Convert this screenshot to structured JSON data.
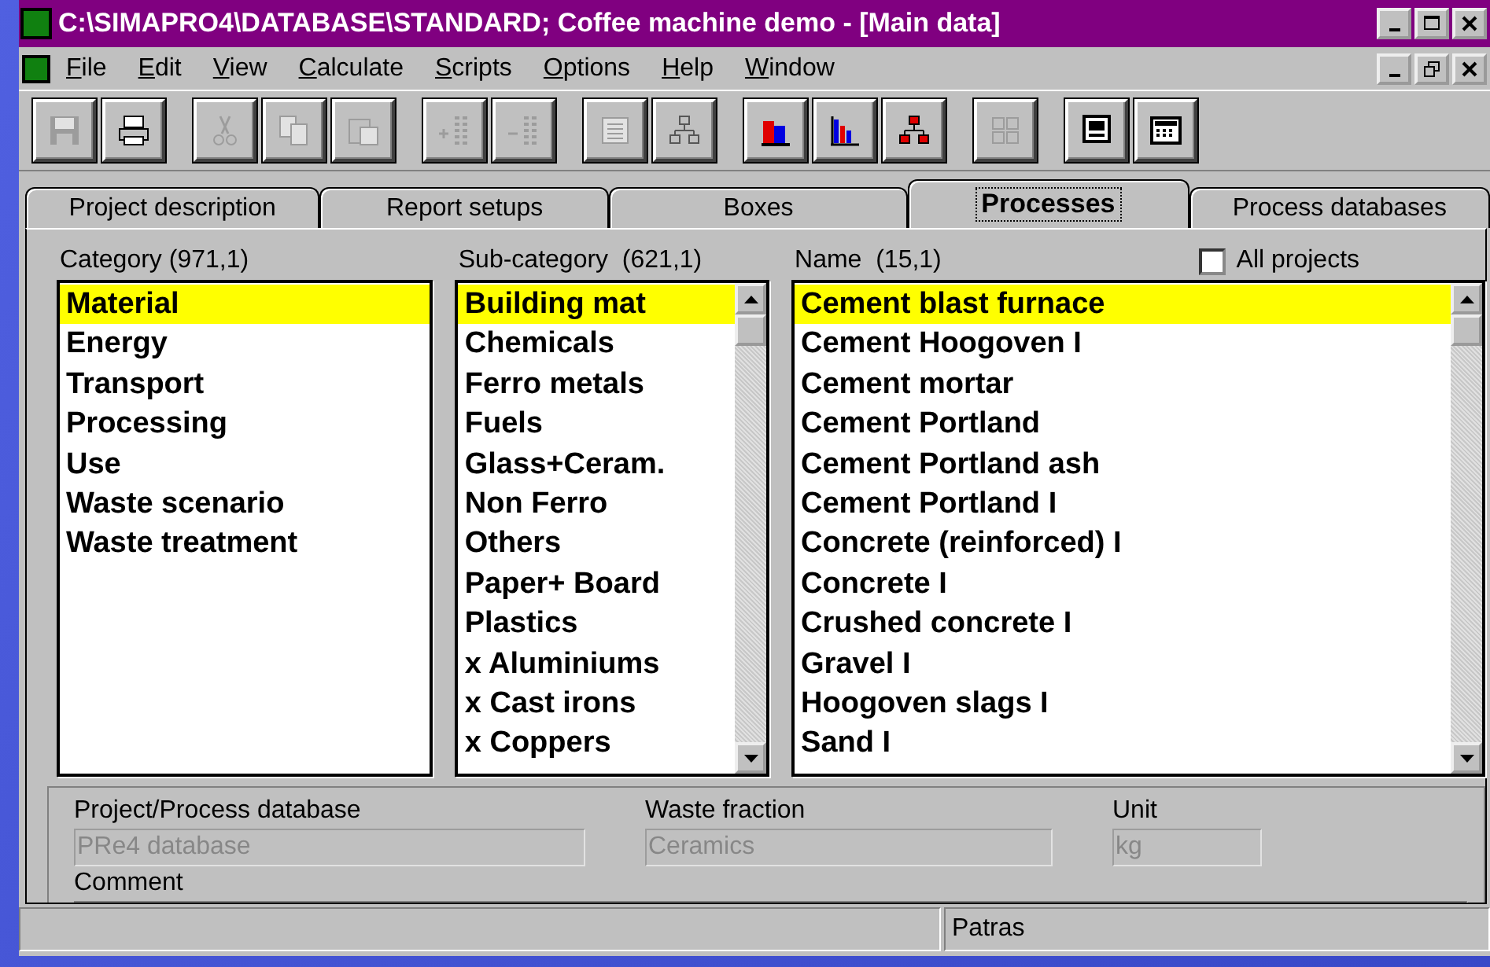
{
  "window": {
    "title": "C:\\SIMAPRO4\\DATABASE\\STANDARD; Coffee machine demo - [Main data]"
  },
  "menu": [
    "File",
    "Edit",
    "View",
    "Calculate",
    "Scripts",
    "Options",
    "Help",
    "Window"
  ],
  "toolbar": [
    [
      {
        "kind": "save",
        "disabled": true
      },
      {
        "kind": "print",
        "disabled": false
      }
    ],
    [
      {
        "kind": "cut",
        "disabled": true
      },
      {
        "kind": "copy",
        "disabled": true
      },
      {
        "kind": "paste",
        "disabled": true
      }
    ],
    [
      {
        "kind": "add-rows",
        "disabled": true
      },
      {
        "kind": "remove-rows",
        "disabled": true
      }
    ],
    [
      {
        "kind": "document",
        "disabled": true
      },
      {
        "kind": "tree",
        "disabled": true
      }
    ],
    [
      {
        "kind": "bar-chart",
        "disabled": false
      },
      {
        "kind": "column-chart",
        "disabled": false
      },
      {
        "kind": "tree",
        "disabled": false
      }
    ],
    [
      {
        "kind": "grid",
        "disabled": true
      }
    ],
    [
      {
        "kind": "monitor",
        "disabled": false
      },
      {
        "kind": "keyboard",
        "disabled": false
      }
    ]
  ],
  "tabs": [
    {
      "label": "Project description",
      "selected": false
    },
    {
      "label": "Report setups",
      "selected": false
    },
    {
      "label": "Boxes",
      "selected": false
    },
    {
      "label": "Processes",
      "selected": true
    },
    {
      "label": "Process databases",
      "selected": false
    }
  ],
  "category": {
    "label": "Category (971,1)",
    "items": [
      {
        "text": "Material",
        "selected": true
      },
      {
        "text": "Energy",
        "selected": false
      },
      {
        "text": "Transport",
        "selected": false
      },
      {
        "text": "Processing",
        "selected": false
      },
      {
        "text": "Use",
        "selected": false
      },
      {
        "text": "Waste scenario",
        "selected": false
      },
      {
        "text": "Waste treatment",
        "selected": false
      }
    ]
  },
  "subcategory": {
    "label": "Sub-category  (621,1)",
    "items": [
      {
        "text": "Building mat",
        "selected": true
      },
      {
        "text": "Chemicals",
        "selected": false
      },
      {
        "text": "Ferro metals",
        "selected": false
      },
      {
        "text": "Fuels",
        "selected": false
      },
      {
        "text": "Glass+Ceram.",
        "selected": false
      },
      {
        "text": "Non Ferro",
        "selected": false
      },
      {
        "text": "Others",
        "selected": false
      },
      {
        "text": "Paper+ Board",
        "selected": false
      },
      {
        "text": "Plastics",
        "selected": false
      },
      {
        "text": "x Aluminiums",
        "selected": false
      },
      {
        "text": "x Cast irons",
        "selected": false
      },
      {
        "text": "x Coppers",
        "selected": false
      }
    ]
  },
  "name": {
    "label": "Name  (15,1)",
    "all_projects": {
      "label": "All projects",
      "checked": false
    },
    "items": [
      {
        "text": "Cement blast furnace",
        "selected": true
      },
      {
        "text": "Cement Hoogoven I",
        "selected": false
      },
      {
        "text": "Cement mortar",
        "selected": false
      },
      {
        "text": "Cement Portland",
        "selected": false
      },
      {
        "text": "Cement Portland ash",
        "selected": false
      },
      {
        "text": "Cement Portland I",
        "selected": false
      },
      {
        "text": "Concrete (reinforced) I",
        "selected": false
      },
      {
        "text": "Concrete I",
        "selected": false
      },
      {
        "text": "Crushed concrete I",
        "selected": false
      },
      {
        "text": "Gravel I",
        "selected": false
      },
      {
        "text": "Hoogoven slags I",
        "selected": false
      },
      {
        "text": "Sand I",
        "selected": false
      }
    ]
  },
  "details": {
    "fields": [
      {
        "label": "Project/Process database",
        "value": "PRe4 database",
        "disabled": true
      },
      {
        "label": "Waste fraction",
        "value": "Ceramics",
        "disabled": true
      },
      {
        "label": "Unit",
        "value": "kg",
        "disabled": true
      }
    ],
    "comment_label": "Comment"
  },
  "status_bar": {
    "location": "Patras"
  }
}
